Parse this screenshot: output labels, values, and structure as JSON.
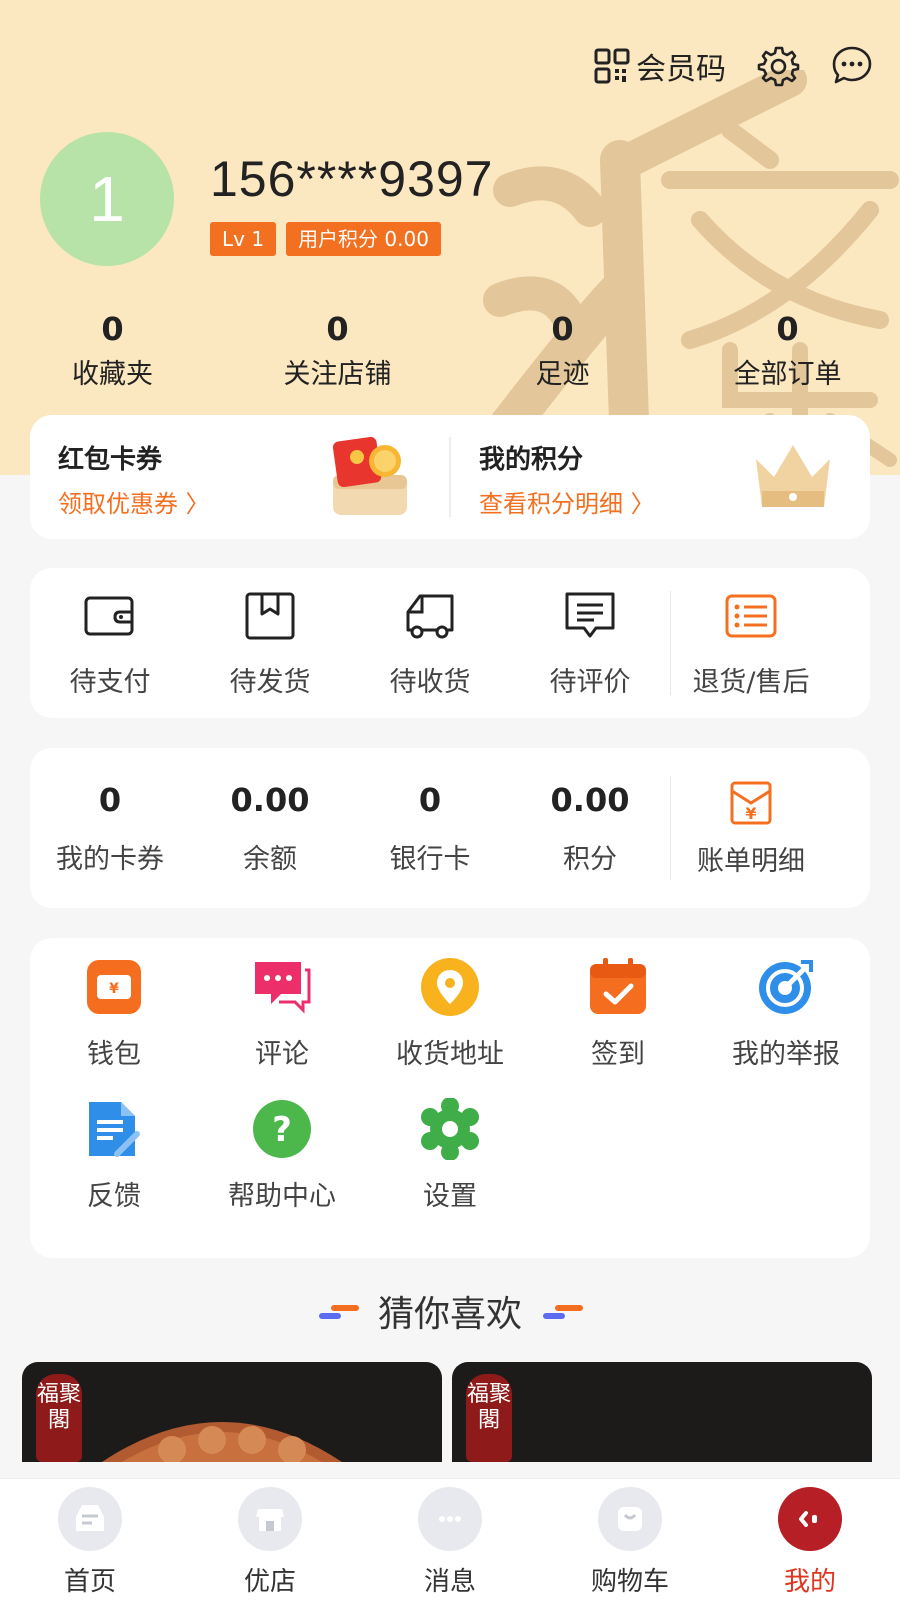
{
  "topbar": {
    "member_code_label": "会员码"
  },
  "profile": {
    "avatar_text": "1",
    "phone": "156****9397",
    "level": "Lv 1",
    "points_badge": "用户积分 0.00"
  },
  "stats": [
    {
      "value": "0",
      "label": "收藏夹"
    },
    {
      "value": "0",
      "label": "关注店铺"
    },
    {
      "value": "0",
      "label": "足迹"
    },
    {
      "value": "0",
      "label": "全部订单"
    }
  ],
  "promo": {
    "coupons": {
      "title": "红包卡券",
      "link": "领取优惠券 〉"
    },
    "points": {
      "title": "我的积分",
      "link": "查看积分明细 〉"
    }
  },
  "orders": [
    {
      "label": "待支付",
      "icon": "wallet-icon"
    },
    {
      "label": "待发货",
      "icon": "box-icon"
    },
    {
      "label": "待收货",
      "icon": "truck-icon"
    },
    {
      "label": "待评价",
      "icon": "comment-icon"
    },
    {
      "label": "退货/售后",
      "icon": "list-icon"
    }
  ],
  "finance": [
    {
      "value": "0",
      "label": "我的卡券"
    },
    {
      "value": "0.00",
      "label": "余额"
    },
    {
      "value": "0",
      "label": "银行卡"
    },
    {
      "value": "0.00",
      "label": "积分"
    }
  ],
  "bill": {
    "label": "账单明细",
    "icon": "bill-icon"
  },
  "tools": [
    {
      "label": "钱包",
      "icon": "wallet-icon"
    },
    {
      "label": "评论",
      "icon": "comment-icon"
    },
    {
      "label": "收货地址",
      "icon": "location-icon"
    },
    {
      "label": "签到",
      "icon": "calendar-check-icon"
    },
    {
      "label": "我的举报",
      "icon": "target-icon"
    },
    {
      "label": "反馈",
      "icon": "document-edit-icon"
    },
    {
      "label": "帮助中心",
      "icon": "question-icon"
    },
    {
      "label": "设置",
      "icon": "gear-icon"
    }
  ],
  "guess": {
    "title": "猜你喜欢"
  },
  "products": [
    {
      "seal": "福聚閣"
    },
    {
      "seal": "福聚閣"
    }
  ],
  "tabbar": [
    {
      "label": "首页",
      "active": false
    },
    {
      "label": "优店",
      "active": false
    },
    {
      "label": "消息",
      "active": false
    },
    {
      "label": "购物车",
      "active": false
    },
    {
      "label": "我的",
      "active": true
    }
  ],
  "colors": {
    "accent": "#f37021",
    "hero_bg": "#fbe7c0",
    "active_tab": "#b51f25"
  }
}
